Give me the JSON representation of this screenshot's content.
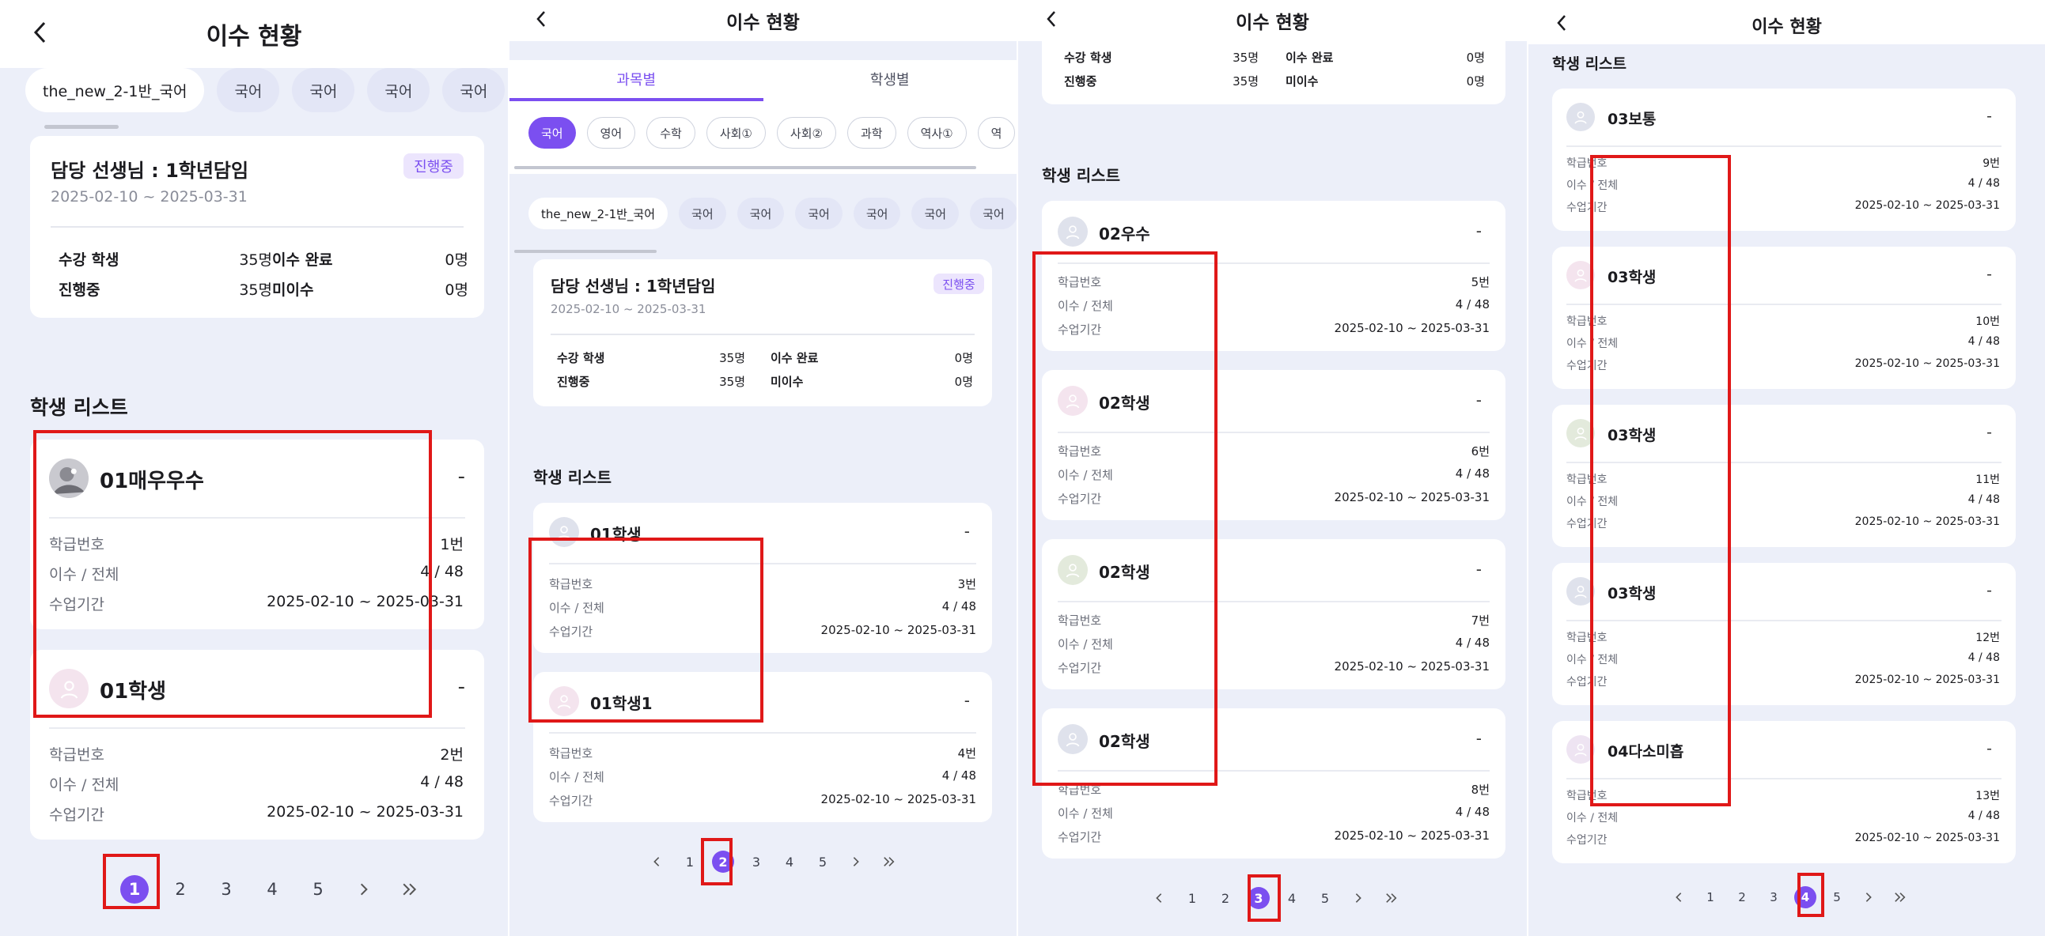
{
  "screen_title": "이수 현황",
  "subject_tabs": [
    "과목별",
    "학생별"
  ],
  "subject_filters": [
    "국어",
    "영어",
    "수학",
    "사회①",
    "사회②",
    "과학",
    "역사①",
    "역"
  ],
  "class_chips": [
    "the_new_2-1반_국어",
    "국어",
    "국어",
    "국어",
    "국어",
    "국어",
    "국어"
  ],
  "teacher": "담당 선생님 : 1학년담임",
  "period": "2025-02-10 ~ 2025-03-31",
  "status_badge": "진행중",
  "stats": {
    "enrolled_label": "수강 학생",
    "enrolled": "35명",
    "completed_label": "이수 완료",
    "completed": "0명",
    "progress_label": "진행중",
    "progress": "35명",
    "incomplete_label": "미이수",
    "incomplete": "0명"
  },
  "section_title": "학생 리스트",
  "field_labels": {
    "number": "학급번호",
    "ratio": "이수 / 전체",
    "period": "수업기간"
  },
  "dash": "-",
  "pages": [
    "1",
    "2",
    "3",
    "4",
    "5"
  ],
  "pages_page2": [
    "1",
    "2",
    "3",
    "4",
    "5"
  ],
  "pages_page3": [
    "1",
    "2",
    "3",
    "4",
    "5"
  ],
  "pages_page4": [
    "1",
    "2",
    "3",
    "4",
    "5"
  ],
  "nav_icons": [
    "back-chevron-icon",
    "prev-chevron-icon",
    "next-chevron-icon",
    "last-chevron-icon"
  ],
  "students_page1": [
    {
      "name": "01매우우수",
      "number": "1번",
      "ratio": "4 / 48",
      "period": "2025-02-10 ~ 2025-03-31"
    },
    {
      "name": "01학생",
      "number": "2번",
      "ratio": "4 / 48",
      "period": "2025-02-10 ~ 2025-03-31"
    }
  ],
  "students_page2": [
    {
      "name": "01학생",
      "number": "3번",
      "ratio": "4 / 48",
      "period": "2025-02-10 ~ 2025-03-31"
    },
    {
      "name": "01학생1",
      "number": "4번",
      "ratio": "4 / 48",
      "period": "2025-02-10 ~ 2025-03-31"
    }
  ],
  "students_page3": [
    {
      "name": "02우수",
      "number": "5번",
      "ratio": "4 / 48",
      "period": "2025-02-10 ~ 2025-03-31"
    },
    {
      "name": "02학생",
      "number": "6번",
      "ratio": "4 / 48",
      "period": "2025-02-10 ~ 2025-03-31"
    },
    {
      "name": "02학생",
      "number": "7번",
      "ratio": "4 / 48",
      "period": "2025-02-10 ~ 2025-03-31"
    },
    {
      "name": "02학생",
      "number": "8번",
      "ratio": "4 / 48",
      "period": "2025-02-10 ~ 2025-03-31"
    }
  ],
  "students_page4": [
    {
      "name": "03보통",
      "number": "9번",
      "ratio": "4 / 48",
      "period": "2025-02-10 ~ 2025-03-31"
    },
    {
      "name": "03학생",
      "number": "10번",
      "ratio": "4 / 48",
      "period": "2025-02-10 ~ 2025-03-31"
    },
    {
      "name": "03학생",
      "number": "11번",
      "ratio": "4 / 48",
      "period": "2025-02-10 ~ 2025-03-31"
    },
    {
      "name": "03학생",
      "number": "12번",
      "ratio": "4 / 48",
      "period": "2025-02-10 ~ 2025-03-31"
    },
    {
      "name": "04다소미흡",
      "number": "13번",
      "ratio": "4 / 48",
      "period": "2025-02-10 ~ 2025-03-31"
    }
  ],
  "colors": {
    "accent": "#7b4ff0",
    "highlight": "#e01818",
    "background": "#eceff9"
  }
}
